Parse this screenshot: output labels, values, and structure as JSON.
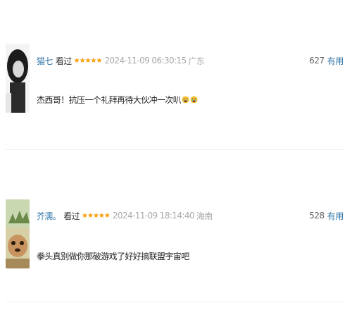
{
  "comments": [
    {
      "username": "猫七",
      "watched_label": "看过",
      "rating_stars": 5,
      "stars": "★★★★★",
      "timestamp": "2024-11-09 06:30:15",
      "location": "广东",
      "vote_count": "627",
      "vote_label": "有用",
      "content": "杰西哥！抗压一个礼拜再待大伙冲一次叭",
      "emojis": [
        "crying-face-emoji",
        "crying-face-emoji"
      ]
    },
    {
      "username": "芥濡。",
      "watched_label": "看过",
      "rating_stars": 5,
      "stars": "★★★★★",
      "timestamp": "2024-11-09 18:14:40",
      "location": "海南",
      "vote_count": "528",
      "vote_label": "有用",
      "content": "拳头真别做你那破游戏了好好搞联盟宇宙吧"
    }
  ],
  "colors": {
    "link": "#3377aa",
    "star": "#f99b01",
    "muted": "#aaaaaa",
    "divider": "#eeeeee"
  }
}
